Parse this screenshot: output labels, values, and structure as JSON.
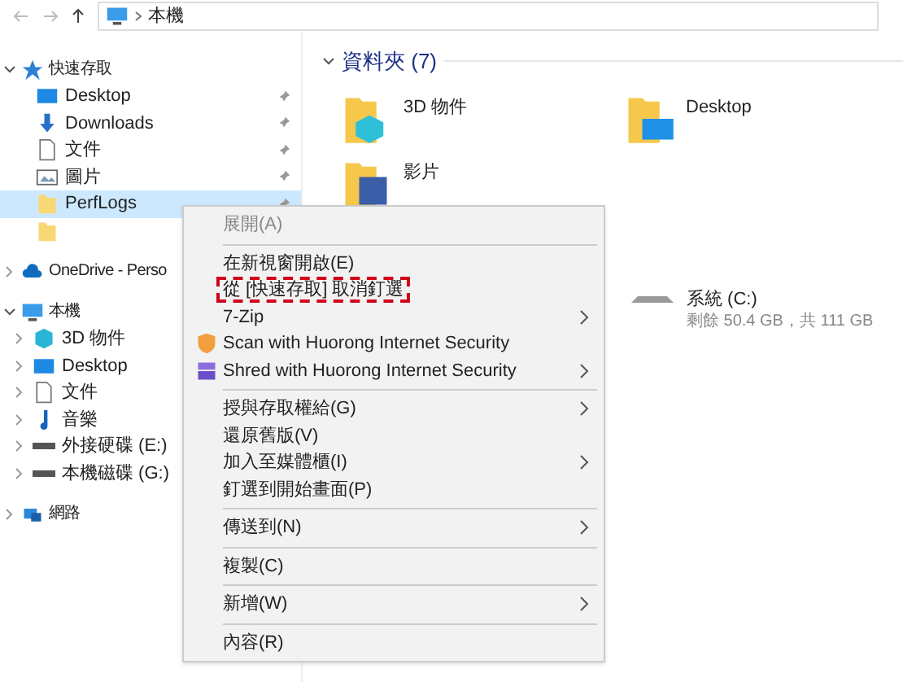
{
  "address_bar": {
    "path": [
      "本機"
    ]
  },
  "sidebar": {
    "items": [
      {
        "label": "快速存取",
        "kind": "star",
        "expanded": true,
        "children": [
          {
            "label": "Desktop",
            "kind": "desktop",
            "pinned": true,
            "selected": false
          },
          {
            "label": "Downloads",
            "kind": "download",
            "pinned": true,
            "selected": false
          },
          {
            "label": "文件",
            "kind": "document",
            "pinned": true,
            "selected": false
          },
          {
            "label": "圖片",
            "kind": "picture",
            "pinned": true,
            "selected": false
          },
          {
            "label": "PerfLogs",
            "kind": "folder",
            "pinned": true,
            "selected": true
          },
          {
            "kind": "folder",
            "pinned": false,
            "selected": false
          }
        ]
      },
      {
        "label": "OneDrive - Perso",
        "kind": "cloud",
        "expanded": false
      },
      {
        "label": "本機",
        "kind": "computer",
        "expanded": true,
        "children": [
          {
            "label": "3D 物件",
            "kind": "cube",
            "selected": false
          },
          {
            "label": "Desktop",
            "kind": "desktop",
            "selected": false
          },
          {
            "label": "文件",
            "kind": "document",
            "selected": false
          },
          {
            "label": "音樂",
            "kind": "music",
            "selected": false
          },
          {
            "label": "外接硬碟 (E:)",
            "kind": "drive",
            "selected": false
          },
          {
            "label": "本機磁碟 (G:)",
            "kind": "drive",
            "selected": false
          }
        ]
      },
      {
        "label": "網路",
        "kind": "network",
        "expanded": false
      }
    ]
  },
  "content": {
    "section": {
      "title": "資料夾 (7)",
      "expanded": true
    },
    "folders": [
      {
        "label": "3D 物件",
        "kind": "cube"
      },
      {
        "label": "Desktop",
        "kind": "desktop"
      },
      {
        "label": "影片",
        "kind": "video"
      }
    ],
    "drive": {
      "label": "系統 (C:)",
      "detail": "剩餘 50.4 GB，共 111 GB"
    }
  },
  "context_menu": {
    "items": [
      {
        "kind": "item",
        "label": "展開(A)",
        "disabled": true,
        "submenu": false,
        "highlighted": false
      },
      {
        "kind": "separator"
      },
      {
        "kind": "item",
        "label": "在新視窗開啟(E)",
        "disabled": false,
        "submenu": false,
        "highlighted": false
      },
      {
        "kind": "item",
        "label": "從 [快速存取] 取消釘選",
        "disabled": false,
        "submenu": false,
        "highlighted": true
      },
      {
        "kind": "item",
        "label": "7-Zip",
        "disabled": false,
        "submenu": true,
        "highlighted": false
      },
      {
        "kind": "scan",
        "label": "Scan with Huorong Internet Security",
        "disabled": false,
        "submenu": false,
        "highlighted": false
      },
      {
        "kind": "shred",
        "label": "Shred with Huorong Internet Security",
        "disabled": false,
        "submenu": true,
        "highlighted": false
      },
      {
        "kind": "separator"
      },
      {
        "kind": "item",
        "label": "授與存取權給(G)",
        "disabled": false,
        "submenu": true,
        "highlighted": false
      },
      {
        "kind": "item",
        "label": "還原舊版(V)",
        "disabled": false,
        "submenu": false,
        "highlighted": false
      },
      {
        "kind": "item",
        "label": "加入至媒體櫃(I)",
        "disabled": false,
        "submenu": true,
        "highlighted": false
      },
      {
        "kind": "item",
        "label": "釘選到開始畫面(P)",
        "disabled": false,
        "submenu": false,
        "highlighted": false
      },
      {
        "kind": "separator"
      },
      {
        "kind": "item",
        "label": "傳送到(N)",
        "disabled": false,
        "submenu": true,
        "highlighted": false
      },
      {
        "kind": "separator"
      },
      {
        "kind": "item",
        "label": "複製(C)",
        "disabled": false,
        "submenu": false,
        "highlighted": false
      },
      {
        "kind": "separator"
      },
      {
        "kind": "item",
        "label": "新增(W)",
        "disabled": false,
        "submenu": true,
        "highlighted": false
      },
      {
        "kind": "separator"
      },
      {
        "kind": "item",
        "label": "內容(R)",
        "disabled": false,
        "submenu": false,
        "highlighted": false
      }
    ]
  }
}
